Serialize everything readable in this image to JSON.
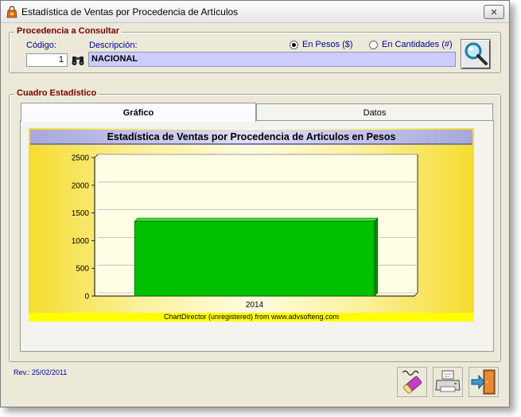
{
  "window": {
    "title": "Estadística de Ventas por Procedencia de Artículos",
    "close_symbol": "✕"
  },
  "procedencia": {
    "group_title": "Procedencia a Consultar",
    "codigo_label": "Código:",
    "codigo_value": "1",
    "descripcion_label": "Descripción:",
    "descripcion_value": "NACIONAL",
    "radio_pesos": "En Pesos ($)",
    "radio_cantidades": "En Cantidades (#)",
    "selected_mode": "pesos"
  },
  "cuadro": {
    "group_title": "Cuadro Estadístico",
    "tabs": [
      {
        "label": "Gráfico",
        "active": true
      },
      {
        "label": "Datos",
        "active": false
      }
    ]
  },
  "chart_data": {
    "type": "bar",
    "title": "Estadística de Ventas por Procedencia de Articulos en Pesos",
    "categories": [
      "2014"
    ],
    "values": [
      1350
    ],
    "ylim": [
      0,
      2500
    ],
    "yticks": [
      0,
      500,
      1000,
      1500,
      2000,
      2500
    ],
    "grid": true,
    "bar_color": "#00c000",
    "footer": "ChartDirector (unregistered) from www.advsofteng.com"
  },
  "footer": {
    "revision": "Rev.: 25/02/2011"
  },
  "icons": {
    "app": "app-bag-icon",
    "find": "binoculars-icon",
    "search": "magnifier-icon",
    "clear": "eraser-icon",
    "print": "printer-icon",
    "exit": "exit-door-icon"
  }
}
